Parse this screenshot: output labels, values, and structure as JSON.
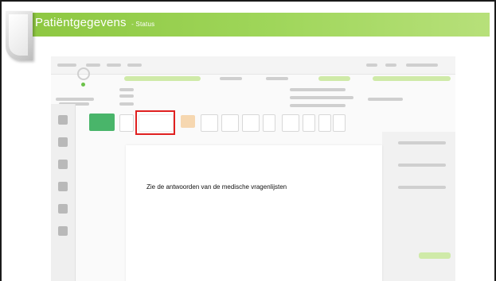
{
  "slide": {
    "title": "Patiëntgegevens",
    "subtitle": "- Status",
    "accent_color": "#8cc63f"
  },
  "screenshot": {
    "document_text": "Zie de antwoorden van de medische vragenlijsten",
    "highlight_color": "#e02020"
  }
}
